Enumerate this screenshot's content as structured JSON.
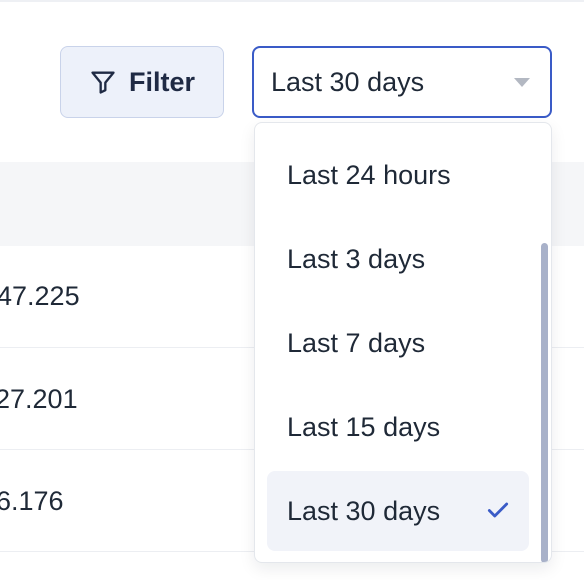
{
  "toolbar": {
    "filter_label": "Filter",
    "filter_icon": "funnel-icon",
    "range_select_value": "Last 30 days",
    "range_select_icon": "caret-down-icon"
  },
  "table": {
    "rows": [
      {
        "value": "47.225"
      },
      {
        "value": "27.201"
      },
      {
        "value": "6.176"
      }
    ]
  },
  "dropdown": {
    "options": [
      {
        "label": "Last 24 hours",
        "selected": false
      },
      {
        "label": "Last 3 days",
        "selected": false
      },
      {
        "label": "Last 7 days",
        "selected": false
      },
      {
        "label": "Last 15 days",
        "selected": false
      },
      {
        "label": "Last 30 days",
        "selected": true
      }
    ],
    "selected_icon": "check-icon"
  },
  "colors": {
    "accent": "#3a5bc7",
    "filter_bg": "#edf1fa",
    "selected_bg": "#f1f3f9",
    "scrollbar": "#a8b1c9"
  }
}
